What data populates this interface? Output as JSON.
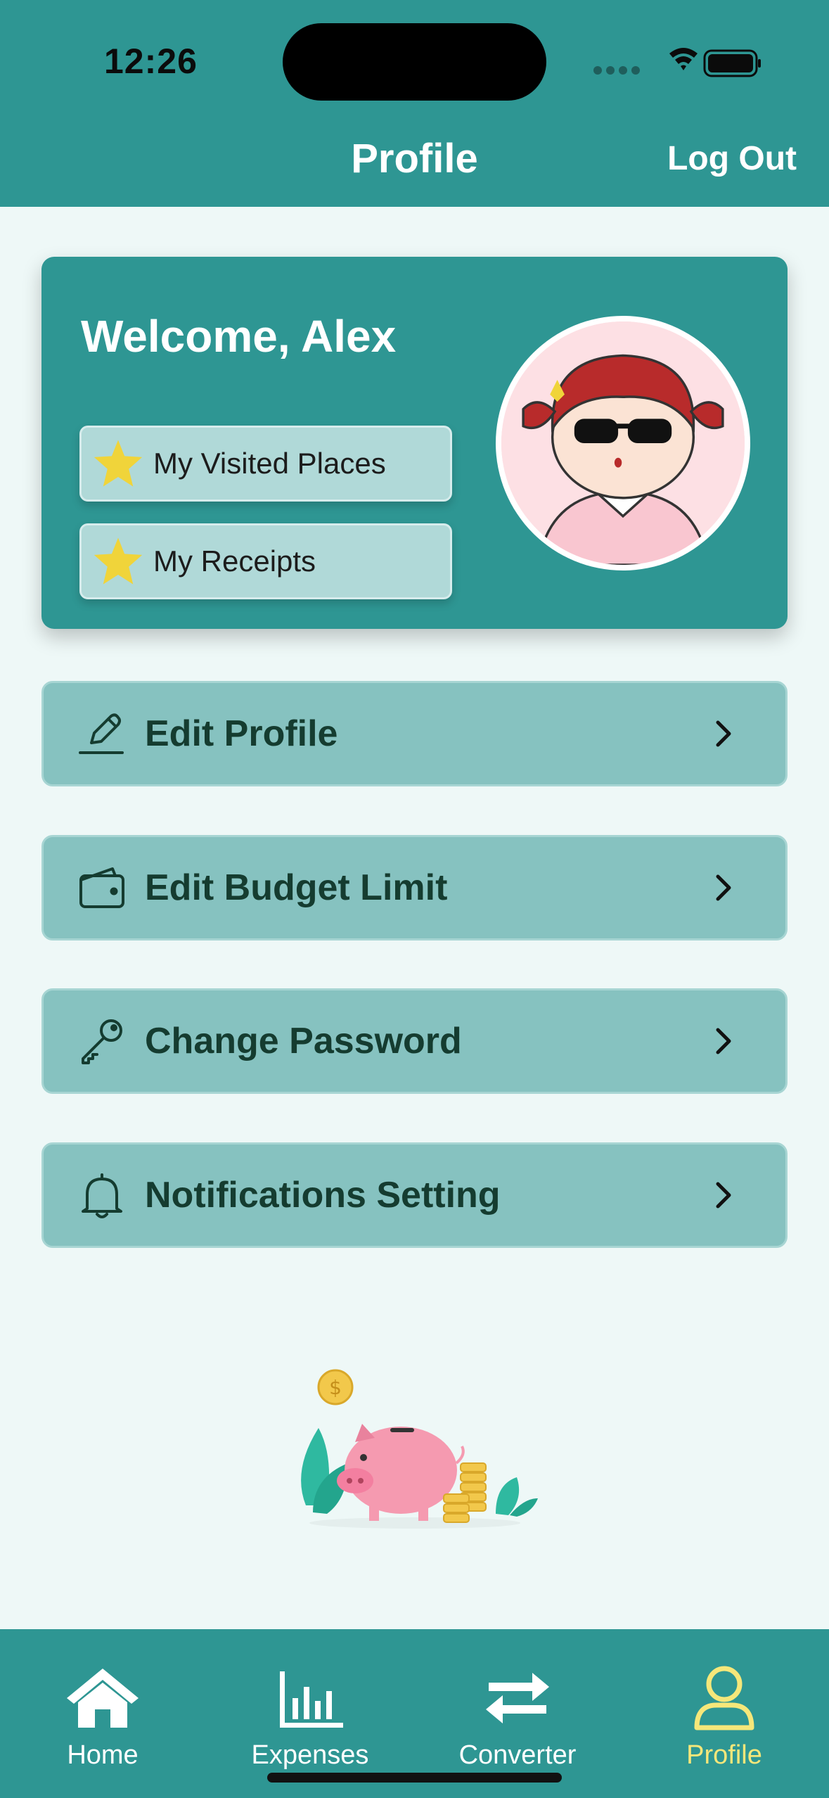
{
  "status_bar": {
    "time": "12:26"
  },
  "header": {
    "title": "Profile",
    "logout_label": "Log Out"
  },
  "welcome": {
    "greeting": "Welcome, Alex",
    "buttons": [
      {
        "label": "My Visited Places",
        "icon": "star-icon"
      },
      {
        "label": "My Receipts",
        "icon": "star-icon"
      }
    ]
  },
  "menu": [
    {
      "label": "Edit Profile",
      "icon": "pencil-icon"
    },
    {
      "label": "Edit Budget Limit",
      "icon": "wallet-icon"
    },
    {
      "label": "Change Password",
      "icon": "key-icon"
    },
    {
      "label": "Notifications Setting",
      "icon": "bell-icon"
    }
  ],
  "tabbar": {
    "tabs": [
      {
        "label": "Home",
        "icon": "home-icon",
        "active": false
      },
      {
        "label": "Expenses",
        "icon": "bar-chart-icon",
        "active": false
      },
      {
        "label": "Converter",
        "icon": "swap-arrows-icon",
        "active": false
      },
      {
        "label": "Profile",
        "icon": "person-icon",
        "active": true
      }
    ]
  },
  "colors": {
    "primary": "#2e9693",
    "background": "#eef8f7",
    "menu_row": "#86c2c0",
    "pill_button": "#b0d9d8",
    "active_tab": "#f5e77a",
    "star": "#f0d43a"
  }
}
